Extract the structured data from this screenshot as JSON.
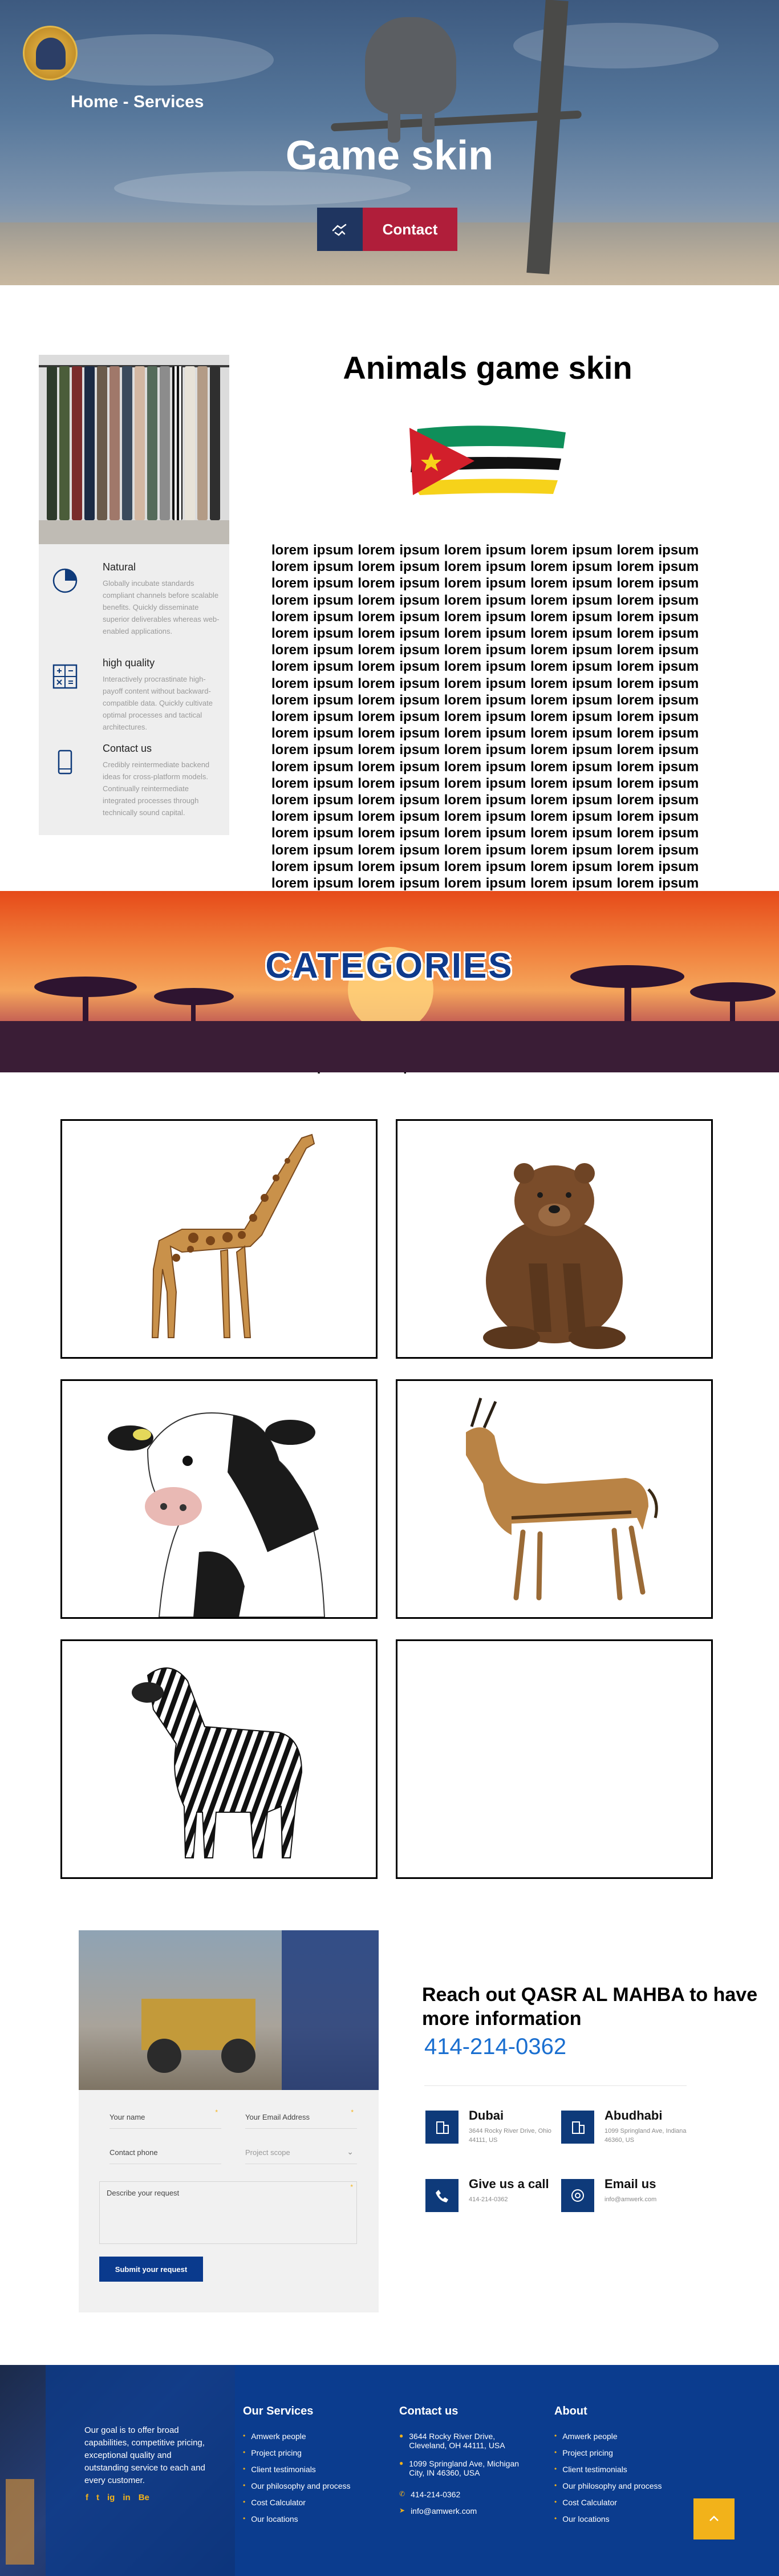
{
  "hero": {
    "breadcrumb": "Home - Services",
    "title": "Game skin",
    "contact_label": "Contact",
    "icon": "handshake-icon"
  },
  "intro": {
    "title": "Animals game skin",
    "features": [
      {
        "title": "Natural",
        "text": "Globally incubate standards compliant channels before scalable benefits. Quickly disseminate superior deliverables whereas web-enabled applications.",
        "icon": "pie-chart-icon"
      },
      {
        "title": "high quality",
        "text": "Interactively procrastinate high-payoff content without backward-compatible data. Quickly cultivate optimal processes and tactical architectures.",
        "icon": "calculator-icon"
      },
      {
        "title": "Contact us",
        "text": "Credibly reintermediate backend ideas for cross-platform models. Continually reintermediate integrated processes through technically sound capital.",
        "icon": "mobile-phone-icon"
      }
    ],
    "body": "lorem ipsum lorem ipsum lorem ipsum lorem ipsum lorem ipsum lorem ipsum lorem ipsum lorem ipsum lorem ipsum lorem ipsum lorem ipsum lorem ipsum lorem ipsum lorem ipsum lorem ipsum lorem ipsum lorem ipsum lorem ipsum lorem ipsum lorem ipsum lorem ipsum lorem ipsum lorem ipsum lorem ipsum lorem ipsum lorem ipsum lorem ipsum lorem ipsum lorem ipsum lorem ipsum lorem ipsum lorem ipsum lorem ipsum lorem ipsum lorem ipsum lorem ipsum lorem ipsum lorem ipsum lorem ipsum lorem ipsum lorem ipsum lorem ipsum lorem ipsum lorem ipsum lorem ipsum lorem ipsum lorem ipsum lorem ipsum lorem ipsum lorem ipsum lorem ipsum lorem ipsum lorem ipsum lorem ipsum lorem ipsum lorem ipsum lorem ipsum lorem ipsum lorem ipsum lorem ipsum lorem ipsum lorem ipsum lorem ipsum lorem ipsum lorem ipsum lorem ipsum lorem ipsum lorem ipsum lorem ipsum lorem ipsum lorem ipsum lorem ipsum lorem ipsum lorem ipsum lorem ipsum lorem ipsum lorem ipsum lorem ipsum lorem ipsum lorem ipsum lorem ipsum lorem ipsum lorem ipsum lorem ipsum lorem ipsum lorem ipsum lorem ipsum lorem ipsum lorem ipsum lorem ipsum lorem ipsum lorem ipsum lorem ipsum lorem ipsum lorem ipsum lorem ipsum lorem ipsum lorem ipsum lorem ipsum lorem ipsum lorem ipsum lorem ipsum lorem ipsum lorem ipsum lorem ipsum lorem ipsum lorem ipsum lorem ipsum lorem ipsum lorem ipsum lorem ipsum lorem ipsum lorem ipsum lorem ipsum lorem ipsum lorem ipsum lorem ipsum lorem ipsum lorem ipsum lorem ipsum lorem ipsum lorem ipsum lorem ipsum lorem ipsum lorem ipsum lorem ipsum lorem ipsum lorem ipsum lorem ipsum lorem ipsum lorem ipsum lorem ipsum lorem ipsum lorem ipsum lorem ipsum lorem ipsum lorem ipsum lorem ipsum lorem ipsum lorem ipsum lorem ipsum lorem ipsum lorem ipsum lorem ipsum lorem ipsum lorem ipsum lorem ipsum lorem ipsum lorem ipsum lorem ipsum lorem ipsum lorem ipsum lorem ipsum lorem ipsum lorem ipsum lorem ipsum lorem ipsum"
  },
  "categories": {
    "title": "CATEGORIES",
    "cards": [
      {
        "animal": "giraffe"
      },
      {
        "animal": "bear"
      },
      {
        "animal": "cow"
      },
      {
        "animal": "gazelle"
      },
      {
        "animal": "zebra"
      },
      {
        "animal": ""
      }
    ]
  },
  "contact": {
    "form": {
      "name_placeholder": "Your name",
      "email_placeholder": "Your Email Address",
      "phone_placeholder": "Contact phone",
      "scope_placeholder": "Project scope",
      "request_placeholder": "Describe your request",
      "submit_label": "Submit your request"
    },
    "heading": "Reach out QASR AL MAHBA to have more information",
    "phone": "414-214-0362",
    "offices": [
      {
        "name": "Dubai",
        "address": "3644 Rocky River Drive, Ohio 44111, US",
        "icon": "building-icon"
      },
      {
        "name": "Abudhabi",
        "address": "1099 Springland Ave, Indiana 46360, US",
        "icon": "building-icon"
      },
      {
        "name": "Give us a call",
        "address": "414-214-0362",
        "icon": "phone-icon"
      },
      {
        "name": "Email us",
        "address": "info@amwerk.com",
        "icon": "email-icon"
      }
    ]
  },
  "footer": {
    "tagline": "Our goal is to offer broad capabilities, competitive pricing, exceptional quality and outstanding service to each and every customer.",
    "socials": [
      "f",
      "t",
      "ig",
      "in",
      "Be"
    ],
    "services": {
      "title": "Our Services",
      "items": [
        "Amwerk people",
        "Project pricing",
        "Client testimonials",
        "Our philosophy and process",
        "Cost Calculator",
        "Our locations"
      ]
    },
    "contact": {
      "title": "Contact us",
      "items": [
        {
          "text": "3644 Rocky River Drive, Cleveland, OH 44111, USA",
          "icon": "location-pin-icon"
        },
        {
          "text": "1099 Springland Ave, Michigan City, IN 46360, USA",
          "icon": "location-pin-icon"
        },
        {
          "text": "414-214-0362",
          "icon": "phone-icon"
        },
        {
          "text": "info@amwerk.com",
          "icon": "send-icon"
        }
      ]
    },
    "about": {
      "title": "About",
      "items": [
        "Amwerk people",
        "Project pricing",
        "Client testimonials",
        "Our philosophy and process",
        "Cost Calculator",
        "Our locations"
      ]
    },
    "to_top_icon": "arrow-up-icon"
  },
  "colors": {
    "brand_blue": "#0b3c8e",
    "accent_red": "#b01e3a",
    "accent_gold": "#f2b21a",
    "phone_blue": "#1a6fd0"
  }
}
